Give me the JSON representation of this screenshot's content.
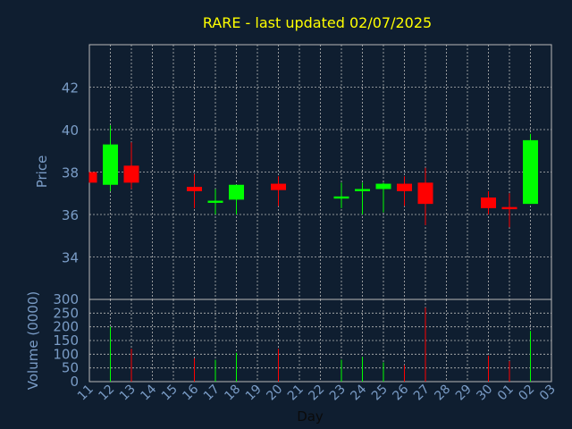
{
  "chart_data": {
    "type": "candlestick",
    "title": "RARE - last updated 02/07/2025",
    "xlabel": "Day",
    "ylabel": "Price",
    "volume_label": "Volume (0000)",
    "x_ticks": [
      "11",
      "12",
      "13",
      "14",
      "15",
      "16",
      "17",
      "18",
      "19",
      "20",
      "21",
      "22",
      "23",
      "24",
      "25",
      "26",
      "27",
      "28",
      "29",
      "30",
      "01",
      "02",
      "03"
    ],
    "price_ticks": [
      34,
      36,
      38,
      40,
      42
    ],
    "price_range": [
      32.0,
      44.0
    ],
    "volume_ticks": [
      0,
      50,
      100,
      150,
      200,
      250,
      300
    ],
    "volume_range": [
      0,
      300
    ],
    "grid": true,
    "colors": {
      "background": "#0f1e30",
      "up": "#00ff00",
      "down": "#ff0000",
      "title": "#ffff00",
      "axis_text": "#7a9cc6",
      "frame": "#b8b8b8",
      "grid": "#b8b8b8"
    },
    "candles": [
      {
        "day": 11,
        "open": 38.0,
        "high": 38.0,
        "low": 37.5,
        "close": 37.5,
        "volume": 0
      },
      {
        "day": 12,
        "open": 37.4,
        "high": 40.2,
        "low": 37.1,
        "close": 39.3,
        "volume": 200
      },
      {
        "day": 13,
        "open": 38.3,
        "high": 39.4,
        "low": 37.2,
        "close": 37.5,
        "volume": 120
      },
      {
        "day": 16,
        "open": 37.3,
        "high": 37.9,
        "low": 36.3,
        "close": 37.1,
        "volume": 85
      },
      {
        "day": 17,
        "open": 36.55,
        "high": 37.2,
        "low": 36.0,
        "close": 36.65,
        "volume": 80
      },
      {
        "day": 18,
        "open": 36.7,
        "high": 37.4,
        "low": 36.0,
        "close": 37.4,
        "volume": 105
      },
      {
        "day": 20,
        "open": 37.45,
        "high": 37.8,
        "low": 36.4,
        "close": 37.15,
        "volume": 120
      },
      {
        "day": 23,
        "open": 36.75,
        "high": 37.5,
        "low": 36.3,
        "close": 36.85,
        "volume": 80
      },
      {
        "day": 24,
        "open": 37.1,
        "high": 37.5,
        "low": 36.0,
        "close": 37.2,
        "volume": 90
      },
      {
        "day": 25,
        "open": 37.2,
        "high": 37.5,
        "low": 36.1,
        "close": 37.45,
        "volume": 70
      },
      {
        "day": 26,
        "open": 37.45,
        "high": 37.8,
        "low": 36.4,
        "close": 37.1,
        "volume": 60
      },
      {
        "day": 27,
        "open": 37.5,
        "high": 38.2,
        "low": 35.5,
        "close": 36.5,
        "volume": 270
      },
      {
        "day": 30,
        "open": 36.8,
        "high": 37.1,
        "low": 36.0,
        "close": 36.3,
        "volume": 95
      },
      {
        "day": "01",
        "open": 36.35,
        "high": 37.0,
        "low": 35.4,
        "close": 36.25,
        "volume": 75
      },
      {
        "day": "02",
        "open": 36.5,
        "high": 39.8,
        "low": 36.5,
        "close": 39.5,
        "volume": 185
      }
    ]
  }
}
